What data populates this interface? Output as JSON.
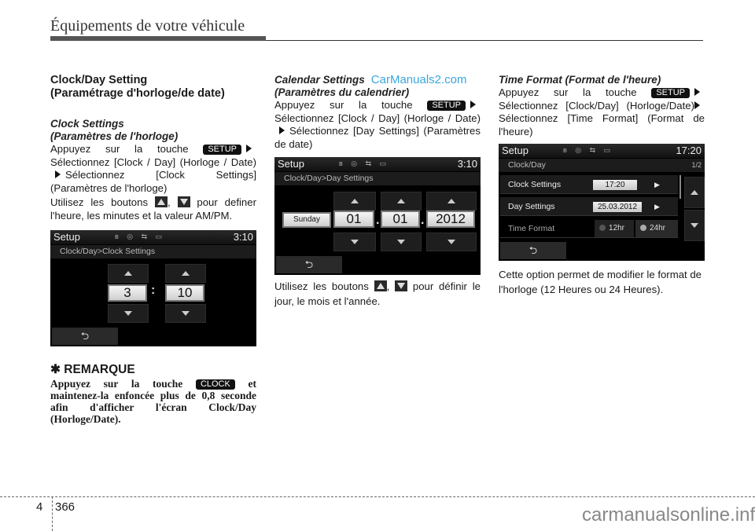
{
  "header": {
    "title": "Équipements de votre véhicule"
  },
  "col1": {
    "heading_line1": "Clock/Day Setting",
    "heading_line2": "(Paramétrage d'horloge/de date)",
    "sub_line1": "Clock Settings",
    "sub_line2": "(Paramètres de l'horloge)",
    "p1_a": "Appuyez sur la touche",
    "key_setup": "SETUP",
    "p1_b": "Sélectionnez [Clock / Day] (Horloge / Date)",
    "p1_c": "Sélectionnez [Clock Settings] (Paramètres de l'horloge)",
    "p2_a": "Utilisez les boutons",
    "p2_b": ",",
    "p2_c": "pour definer l'heure, les minutes et la valeur AM/PM.",
    "screen": {
      "title": "Setup",
      "time": "3:10",
      "status_icons": "ʙ ◎ ⇆ ▭",
      "breadcrumb": "Clock/Day>Clock Settings",
      "hour": "3",
      "separator": ":",
      "minute": "10",
      "back": "⮌"
    },
    "note_title": "✱ REMARQUE",
    "note_a": "Appuyez sur la touche",
    "key_clock": "CLOCK",
    "note_b": "et maintenez-la enfoncée plus de 0,8 seconde afin d'afficher l'écran Clock/Day (Horloge/Date)."
  },
  "col2": {
    "sub_line1": "Calendar Settings",
    "watermark": "CarManuals2.com",
    "sub_line2": "(Paramètres du calendrier)",
    "p1_a": "Appuyez sur la touche",
    "key_setup": "SETUP",
    "p1_b": "Sélectionnez [Clock / Day] (Horloge / Date)",
    "p1_c": "Sélectionnez [Day Settings] (Paramètres de date)",
    "screen": {
      "title": "Setup",
      "time": "3:10",
      "status_icons": "ʙ ◎ ⇆ ▭",
      "breadcrumb": "Clock/Day>Day Settings",
      "weekday": "Sunday",
      "day": "01",
      "month": "01",
      "year": "2012",
      "dot": ".",
      "back": "⮌"
    },
    "p2_a": "Utilisez les boutons",
    "p2_b": ",",
    "p2_c": "pour définir le jour, le mois et l'année."
  },
  "col3": {
    "sub_line1": "Time Format (Format de l'heure)",
    "p1_a": "Appuyez sur la touche",
    "key_setup": "SETUP",
    "p1_b": "Sélectionnez [Clock/Day] (Horloge/Date)",
    "p1_c": "Sélectionnez [Time Format] (Format de l'heure)",
    "screen": {
      "title": "Setup",
      "time": "17:20",
      "status_icons": "ʙ ◎ ⇆ ▭",
      "breadcrumb": "Clock/Day",
      "page": "1/2",
      "rows": [
        {
          "label": "Clock Settings",
          "value": "17:20"
        },
        {
          "label": "Day Settings",
          "value": "25.03.2012"
        },
        {
          "label": "Time Format"
        }
      ],
      "opt_12": "12hr",
      "opt_24": "24hr",
      "back": "⮌"
    },
    "p2": "Cette option permet de modifier le format de l'horloge (12 Heures ou 24 Heures)."
  },
  "footer": {
    "chapter": "4",
    "page": "366",
    "watermark": "carmanualsonline.info"
  }
}
